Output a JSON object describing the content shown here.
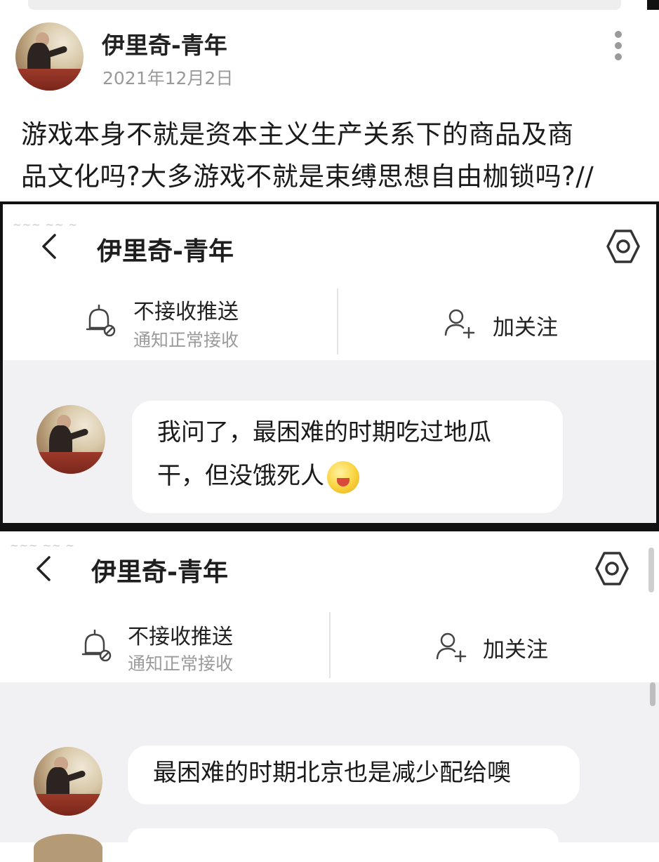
{
  "post": {
    "author": "伊里奇-青年",
    "date": "2021年12月2日",
    "body_line1": "游戏本身不就是资本主义生产关系下的商品及商",
    "body_line2": "品文化吗?大多游戏不就是束缚思想自由枷锁吗?//"
  },
  "chat1": {
    "title": "伊里奇-青年",
    "notify_label": "不接收推送",
    "notify_sub": "通知正常接收",
    "follow_label": "加关注",
    "message_line1": "我问了，最困难的时期吃过地瓜",
    "message_line2": "干，但没饿死人"
  },
  "chat2": {
    "title": "伊里奇-青年",
    "notify_label": "不接收推送",
    "notify_sub": "通知正常接收",
    "follow_label": "加关注",
    "message": "最困难的时期北京也是减少配给噢"
  },
  "icons": {
    "back": "chevron-left-icon",
    "settings": "hexagon-settings-icon",
    "notify": "bell-muted-icon",
    "follow": "person-add-icon",
    "more": "vertical-dots-icon",
    "emoji": "face-emoji-icon"
  }
}
